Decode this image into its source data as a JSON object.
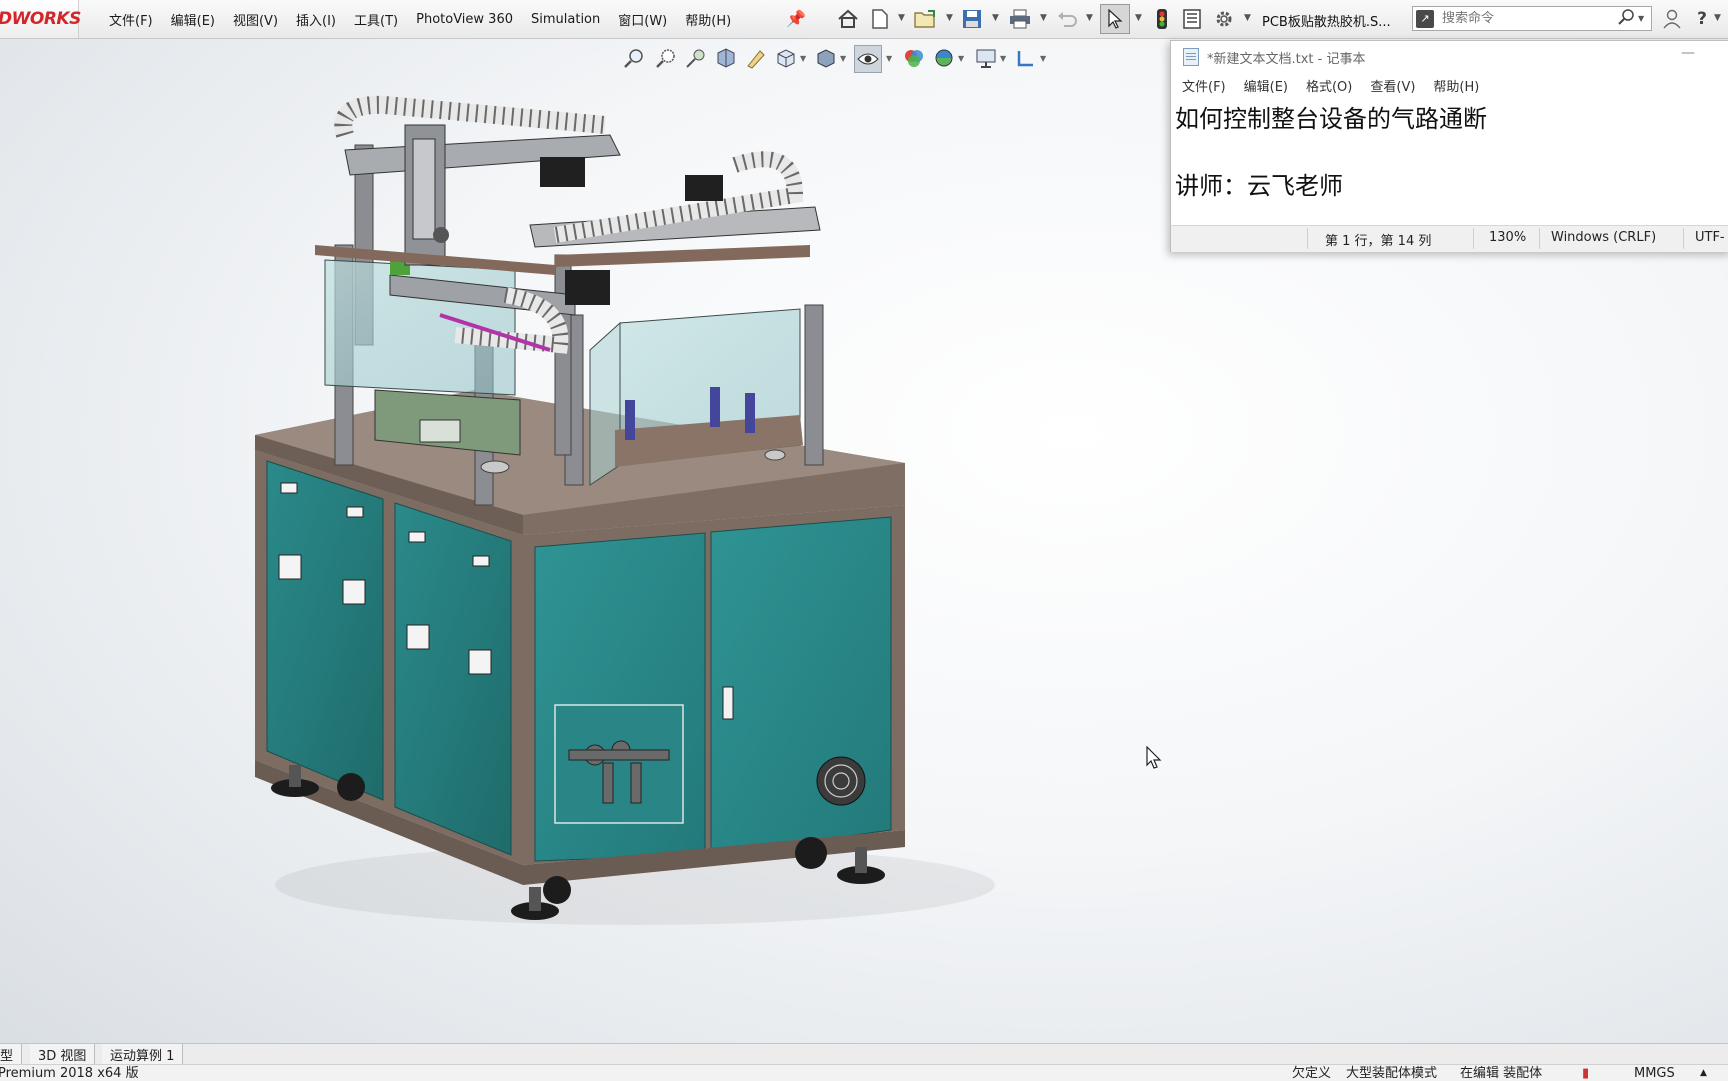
{
  "app": {
    "logo_text": "DWORKS",
    "menu": [
      "文件(F)",
      "编辑(E)",
      "视图(V)",
      "插入(I)",
      "工具(T)",
      "PhotoView 360",
      "Simulation",
      "窗口(W)",
      "帮助(H)"
    ],
    "document_title": "PCB板贴散热胶机.S...",
    "search_placeholder": "搜索命令"
  },
  "notepad": {
    "title": "*新建文本文档.txt - 记事本",
    "menu": [
      "文件(F)",
      "编辑(E)",
      "格式(O)",
      "查看(V)",
      "帮助(H)"
    ],
    "lines": [
      "如何控制整台设备的气路通断",
      "",
      "讲师：云飞老师"
    ],
    "status": {
      "position": "第 1 行，第 14 列",
      "zoom": "130%",
      "line_ending": "Windows (CRLF)",
      "encoding": "UTF-"
    }
  },
  "tabs": [
    "型",
    "3D 视图",
    "运动算例 1"
  ],
  "statusbar": {
    "left": "Premium 2018 x64 版",
    "defined": "欠定义",
    "mode": "大型装配体模式",
    "editing": "在编辑 装配体",
    "units": "MMGS"
  },
  "colors": {
    "accent": "#d4252b",
    "cabinet_teal": "#2a8585",
    "frame_brown": "#7a6a60"
  }
}
